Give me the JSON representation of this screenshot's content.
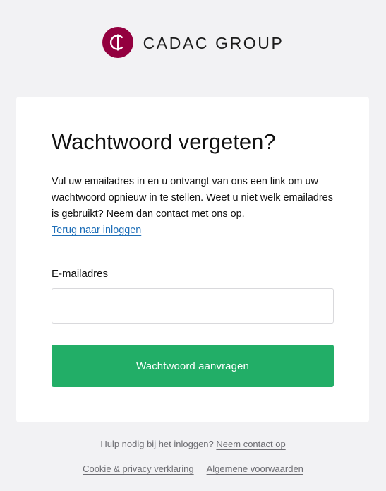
{
  "brand": {
    "name": "CADAC GROUP",
    "logo_icon": "cadac-logo-icon",
    "logo_color": "#93003f"
  },
  "card": {
    "title": "Wachtwoord vergeten?",
    "intro": "Vul uw emailadres in en u ontvangt van ons een link om uw wachtwoord opnieuw in te stellen. Weet u niet welk emailadres is gebruikt? Neem dan contact met ons op.",
    "back_link": "Terug naar inloggen",
    "email_label": "E-mailadres",
    "email_value": "",
    "email_placeholder": "",
    "submit_label": "Wachtwoord aanvragen"
  },
  "footer": {
    "help_text": "Hulp nodig bij het inloggen?",
    "help_link": "Neem contact op",
    "privacy_link": "Cookie & privacy verklaring",
    "terms_link": "Algemene voorwaarden"
  },
  "colors": {
    "background": "#f2f2f4",
    "accent_button": "#22ae67",
    "link": "#1f6fb8",
    "brand": "#93003f"
  }
}
